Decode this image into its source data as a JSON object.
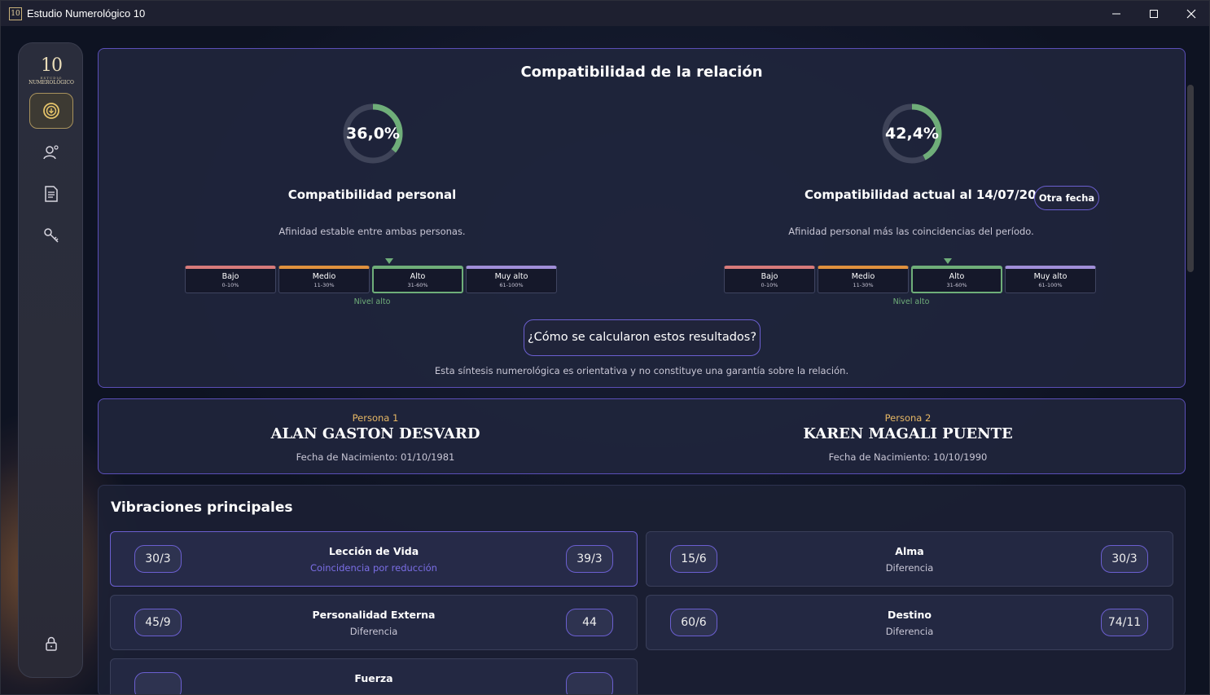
{
  "window": {
    "title": "Estudio Numerológico 10",
    "app_icon_text": "10",
    "controls": {
      "minimize": "minimize-icon",
      "maximize": "maximize-icon",
      "close": "close-icon"
    }
  },
  "sidebar": {
    "logo": {
      "number": "10",
      "line1": "ESTUDIO",
      "line2": "NUMEROLÓGICO"
    },
    "items": [
      {
        "icon": "compatibility-icon",
        "active": true
      },
      {
        "icon": "users-icon",
        "active": false
      },
      {
        "icon": "document-icon",
        "active": false
      },
      {
        "icon": "key-icon",
        "active": false
      }
    ],
    "bottom_icon": "lock-icon"
  },
  "compat": {
    "title": "Compatibilidad de la relación",
    "personal": {
      "value": "36,0%",
      "percent": 36.0,
      "title": "Compatibilidad personal",
      "desc": "Afinidad estable entre ambas personas.",
      "level": "Nivel alto"
    },
    "current": {
      "value": "42,4%",
      "percent": 42.4,
      "title": "Compatibilidad actual al 14/07/2026",
      "desc": "Afinidad personal más las coincidencias del período.",
      "level": "Nivel alto"
    },
    "scale": [
      {
        "label": "Bajo",
        "range": "0-10%",
        "color": "#d77a7a"
      },
      {
        "label": "Medio",
        "range": "11-30%",
        "color": "#e0913e"
      },
      {
        "label": "Alto",
        "range": "31-60%",
        "color": "#6fae79"
      },
      {
        "label": "Muy alto",
        "range": "61-100%",
        "color": "#a08ed8"
      }
    ],
    "other_date_button": "Otra fecha",
    "how_button": "¿Cómo se calcularon estos resultados?",
    "disclaimer": "Esta síntesis numerológica es orientativa y no constituye una garantía sobre la relación."
  },
  "persons": [
    {
      "label": "Persona 1",
      "name": "ALAN GASTON DESVARD",
      "birth": "Fecha de Nacimiento: 01/10/1981"
    },
    {
      "label": "Persona 2",
      "name": "KAREN MAGALI PUENTE",
      "birth": "Fecha de Nacimiento: 10/10/1990"
    }
  ],
  "vibes": {
    "title": "Vibraciones principales",
    "rows": [
      {
        "left": "30/3",
        "name": "Lección de Vida",
        "sub": "Coincidencia por reducción",
        "right": "39/3"
      },
      {
        "left": "15/6",
        "name": "Alma",
        "sub": "Diferencia",
        "right": "30/3"
      },
      {
        "left": "45/9",
        "name": "Personalidad Externa",
        "sub": "Diferencia",
        "right": "44"
      },
      {
        "left": "60/6",
        "name": "Destino",
        "sub": "Diferencia",
        "right": "74/11"
      },
      {
        "left": "",
        "name": "Fuerza",
        "sub": "",
        "right": ""
      }
    ]
  },
  "colors": {
    "accent": "#6b5fd0",
    "gold": "#e7b865",
    "green": "#6fae79"
  }
}
